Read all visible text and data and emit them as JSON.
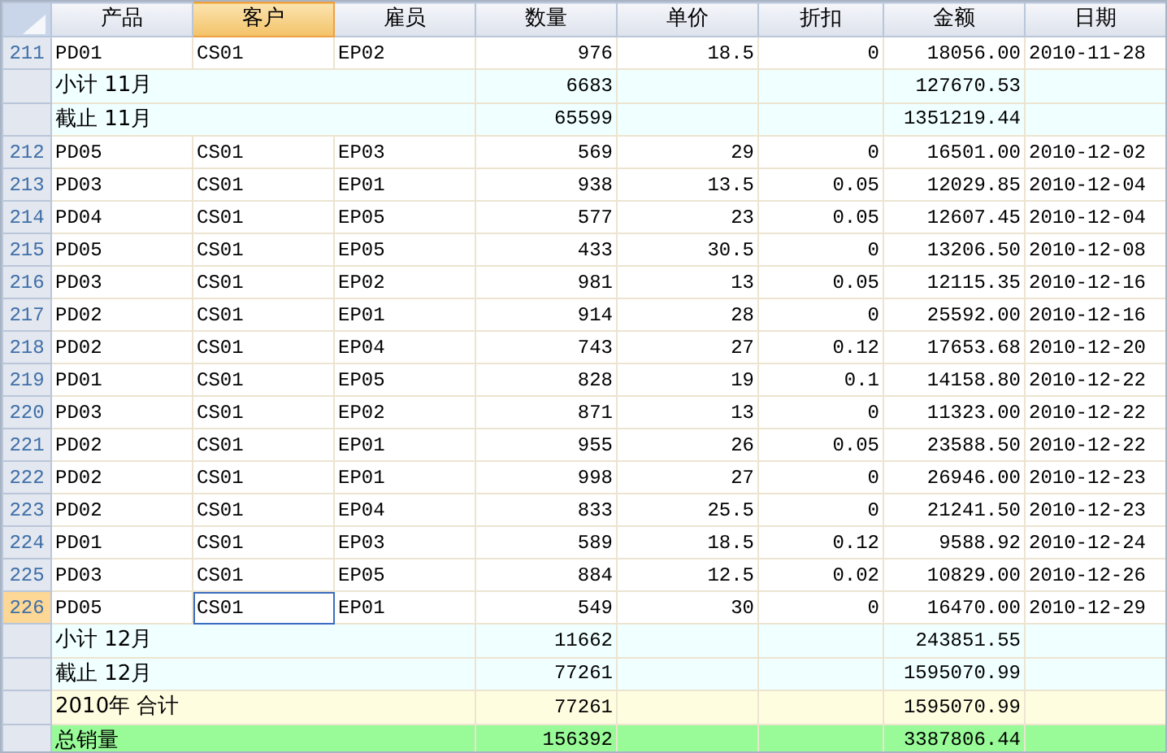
{
  "columns": [
    {
      "label": "产品",
      "selected": false
    },
    {
      "label": "客户",
      "selected": true
    },
    {
      "label": "雇员",
      "selected": false
    },
    {
      "label": "数量",
      "selected": false
    },
    {
      "label": "单价",
      "selected": false
    },
    {
      "label": "折扣",
      "selected": false
    },
    {
      "label": "金额",
      "selected": false
    },
    {
      "label": "日期",
      "selected": false
    }
  ],
  "rows": [
    {
      "kind": "data",
      "number": "211",
      "selected": false,
      "cells": [
        "PD01",
        "CS01",
        "EP02",
        "976",
        "18.5",
        "0",
        "18056.00",
        "2010-11-28"
      ]
    },
    {
      "kind": "subtotal",
      "label": "小计 11月",
      "quantity": "6683",
      "amount": "127670.53"
    },
    {
      "kind": "cumulative",
      "label": "截止 11月",
      "quantity": "65599",
      "amount": "1351219.44"
    },
    {
      "kind": "data",
      "number": "212",
      "selected": false,
      "cells": [
        "PD05",
        "CS01",
        "EP03",
        "569",
        "29",
        "0",
        "16501.00",
        "2010-12-02"
      ]
    },
    {
      "kind": "data",
      "number": "213",
      "selected": false,
      "cells": [
        "PD03",
        "CS01",
        "EP01",
        "938",
        "13.5",
        "0.05",
        "12029.85",
        "2010-12-04"
      ]
    },
    {
      "kind": "data",
      "number": "214",
      "selected": false,
      "cells": [
        "PD04",
        "CS01",
        "EP05",
        "577",
        "23",
        "0.05",
        "12607.45",
        "2010-12-04"
      ]
    },
    {
      "kind": "data",
      "number": "215",
      "selected": false,
      "cells": [
        "PD05",
        "CS01",
        "EP05",
        "433",
        "30.5",
        "0",
        "13206.50",
        "2010-12-08"
      ]
    },
    {
      "kind": "data",
      "number": "216",
      "selected": false,
      "cells": [
        "PD03",
        "CS01",
        "EP02",
        "981",
        "13",
        "0.05",
        "12115.35",
        "2010-12-16"
      ]
    },
    {
      "kind": "data",
      "number": "217",
      "selected": false,
      "cells": [
        "PD02",
        "CS01",
        "EP01",
        "914",
        "28",
        "0",
        "25592.00",
        "2010-12-16"
      ]
    },
    {
      "kind": "data",
      "number": "218",
      "selected": false,
      "cells": [
        "PD02",
        "CS01",
        "EP04",
        "743",
        "27",
        "0.12",
        "17653.68",
        "2010-12-20"
      ]
    },
    {
      "kind": "data",
      "number": "219",
      "selected": false,
      "cells": [
        "PD01",
        "CS01",
        "EP05",
        "828",
        "19",
        "0.1",
        "14158.80",
        "2010-12-22"
      ]
    },
    {
      "kind": "data",
      "number": "220",
      "selected": false,
      "cells": [
        "PD03",
        "CS01",
        "EP02",
        "871",
        "13",
        "0",
        "11323.00",
        "2010-12-22"
      ]
    },
    {
      "kind": "data",
      "number": "221",
      "selected": false,
      "cells": [
        "PD02",
        "CS01",
        "EP01",
        "955",
        "26",
        "0.05",
        "23588.50",
        "2010-12-22"
      ]
    },
    {
      "kind": "data",
      "number": "222",
      "selected": false,
      "cells": [
        "PD02",
        "CS01",
        "EP01",
        "998",
        "27",
        "0",
        "26946.00",
        "2010-12-23"
      ]
    },
    {
      "kind": "data",
      "number": "223",
      "selected": false,
      "cells": [
        "PD02",
        "CS01",
        "EP04",
        "833",
        "25.5",
        "0",
        "21241.50",
        "2010-12-23"
      ]
    },
    {
      "kind": "data",
      "number": "224",
      "selected": false,
      "cells": [
        "PD01",
        "CS01",
        "EP03",
        "589",
        "18.5",
        "0.12",
        "9588.92",
        "2010-12-24"
      ]
    },
    {
      "kind": "data",
      "number": "225",
      "selected": false,
      "cells": [
        "PD03",
        "CS01",
        "EP05",
        "884",
        "12.5",
        "0.02",
        "10829.00",
        "2010-12-26"
      ]
    },
    {
      "kind": "data",
      "number": "226",
      "selected": true,
      "cells": [
        "PD05",
        "CS01",
        "EP01",
        "549",
        "30",
        "0",
        "16470.00",
        "2010-12-29"
      ]
    },
    {
      "kind": "subtotal",
      "label": "小计 12月",
      "quantity": "11662",
      "amount": "243851.55"
    },
    {
      "kind": "cumulative",
      "label": "截止 12月",
      "quantity": "77261",
      "amount": "1595070.99"
    },
    {
      "kind": "year_total",
      "label": "2010年 合计",
      "quantity": "77261",
      "amount": "1595070.99"
    },
    {
      "kind": "grand_total",
      "label": "总销量",
      "quantity": "156392",
      "amount": "3387806.44"
    }
  ]
}
